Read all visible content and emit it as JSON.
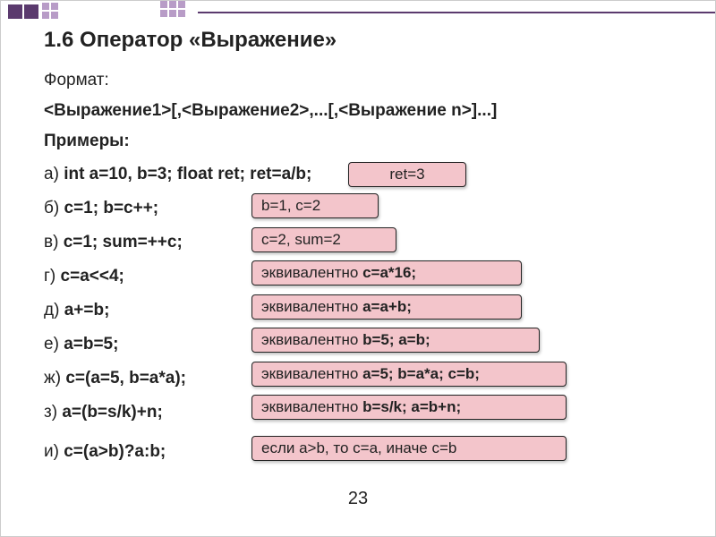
{
  "title": "1.6 Оператор «Выражение»",
  "format_label": "Формат:",
  "format_syntax": "<Выражение1>[,<Выражение2>,...[,<Выражение n>]...]",
  "examples_label": "Примеры:",
  "rows": {
    "a": {
      "prefix": "а) ",
      "bold": "int  a=10, b=3; float ret; ret=a/b;"
    },
    "b": {
      "prefix": "б) ",
      "bold": "c=1;   b=c++;"
    },
    "v": {
      "prefix": "в) ",
      "bold": "c=1;    sum=++c;"
    },
    "g": {
      "prefix": "г) ",
      "bold": "c=a<<4;"
    },
    "d": {
      "prefix": "д) ",
      "bold": "a+=b;"
    },
    "e": {
      "prefix": "е) ",
      "bold": "a=b=5;"
    },
    "zh": {
      "prefix": "ж) ",
      "bold": "c=(a=5, b=a*a);"
    },
    "z": {
      "prefix": "з) ",
      "bold": "a=(b=s/k)+n;"
    },
    "i": {
      "prefix": "и) ",
      "bold": "c=(a>b)?a:b;"
    }
  },
  "boxes": {
    "ret": "ret=3",
    "b1c2": "b=1,  c=2",
    "c2sum2": "c=2, sum=2",
    "a16_pre": "эквивалентно ",
    "a16_bold": "c=a*16;",
    "aab_pre": "эквивалентно ",
    "aab_bold": "a=a+b;",
    "b5ab_pre": "эквивалентно ",
    "b5ab_bold": "b=5; a=b;",
    "a5baa_pre": "эквивалентно ",
    "a5baa_bold": "a=5; b=a*a; c=b;",
    "bsk_pre": "эквивалентно ",
    "bsk_bold": "b=s/k; a=b+n;",
    "ternary": "если a>b, то c=a, иначе c=b"
  },
  "page_number": "23"
}
